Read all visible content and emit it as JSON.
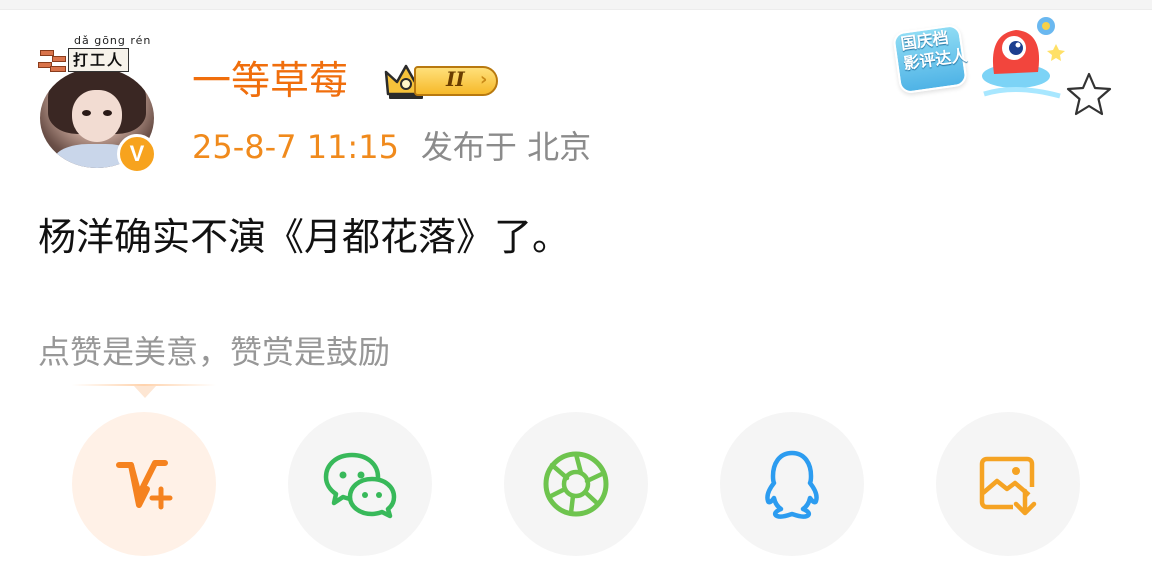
{
  "post": {
    "author_tag_pinyin": "dǎ gōng rén",
    "author_tag": "打工人",
    "username": "一等草莓",
    "vip_level": "II",
    "verified_mark": "V",
    "timestamp": "25-8-7 11:15",
    "location": "发布于 北京",
    "content": "杨洋确实不演《月都花落》了。"
  },
  "promo": {
    "badge_text_line1": "国庆档",
    "badge_text_line2": "影评达人"
  },
  "reward": {
    "hint": "点赞是美意，赞赏是鼓励"
  },
  "share_targets": [
    {
      "name": "v-plus",
      "icon": "v-plus-icon",
      "color": "#f5821f"
    },
    {
      "name": "wechat",
      "icon": "wechat-icon",
      "color": "#38b95a"
    },
    {
      "name": "moments",
      "icon": "moments-icon",
      "color": "#6ec44e"
    },
    {
      "name": "qq",
      "icon": "qq-icon",
      "color": "#2c9cf0"
    },
    {
      "name": "save-image",
      "icon": "save-image-icon",
      "color": "#f5a323"
    }
  ],
  "colors": {
    "accent": "#f06e0c",
    "timestamp": "#f08a1c",
    "muted": "#8b8b8b"
  }
}
